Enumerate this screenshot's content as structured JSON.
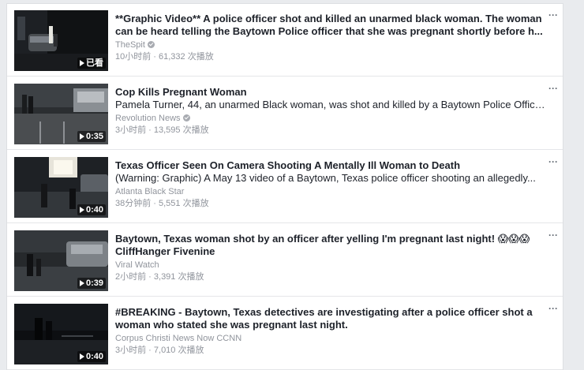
{
  "videos": [
    {
      "title": "**Graphic Video** A police officer shot and killed an unarmed black woman. The woman can be heard telling the Baytown Police officer that she was pregnant shortly before h...",
      "description": "",
      "source": "TheSpit",
      "verified": true,
      "meta": "10小时前 · 61,332 次播放",
      "duration": "已看",
      "options": "···"
    },
    {
      "title": "Cop Kills Pregnant Woman",
      "description": "Pamela Turner, 44, an unarmed Black woman, was shot and killed by a Baytown Police Office...",
      "source": "Revolution News",
      "verified": true,
      "meta": "3小时前 · 13,595 次播放",
      "duration": "0:35",
      "options": "···"
    },
    {
      "title": "Texas Officer Seen On Camera Shooting A Mentally Ill Woman to Death",
      "description": "(Warning: Graphic) A May 13 video of a Baytown, Texas police officer shooting an allegedly...",
      "source": "Atlanta Black Star",
      "verified": false,
      "meta": "38分钟前 · 5,551 次播放",
      "duration": "0:40",
      "options": "···"
    },
    {
      "title": "Baytown, Texas woman shot by an officer after yelling I'm pregnant last night! 😱😱😱 CliffHanger Fivenine",
      "description": "",
      "source": "Viral Watch",
      "verified": false,
      "meta": "2小时前 · 3,391 次播放",
      "duration": "0:39",
      "options": "···"
    },
    {
      "title": "#BREAKING - Baytown, Texas detectives are investigating after a police officer shot a woman who stated she was pregnant last night.",
      "description": "",
      "source": "Corpus Christi News Now CCNN",
      "verified": false,
      "meta": "3小时前 · 7,010 次播放",
      "duration": "0:40",
      "options": "···"
    }
  ]
}
